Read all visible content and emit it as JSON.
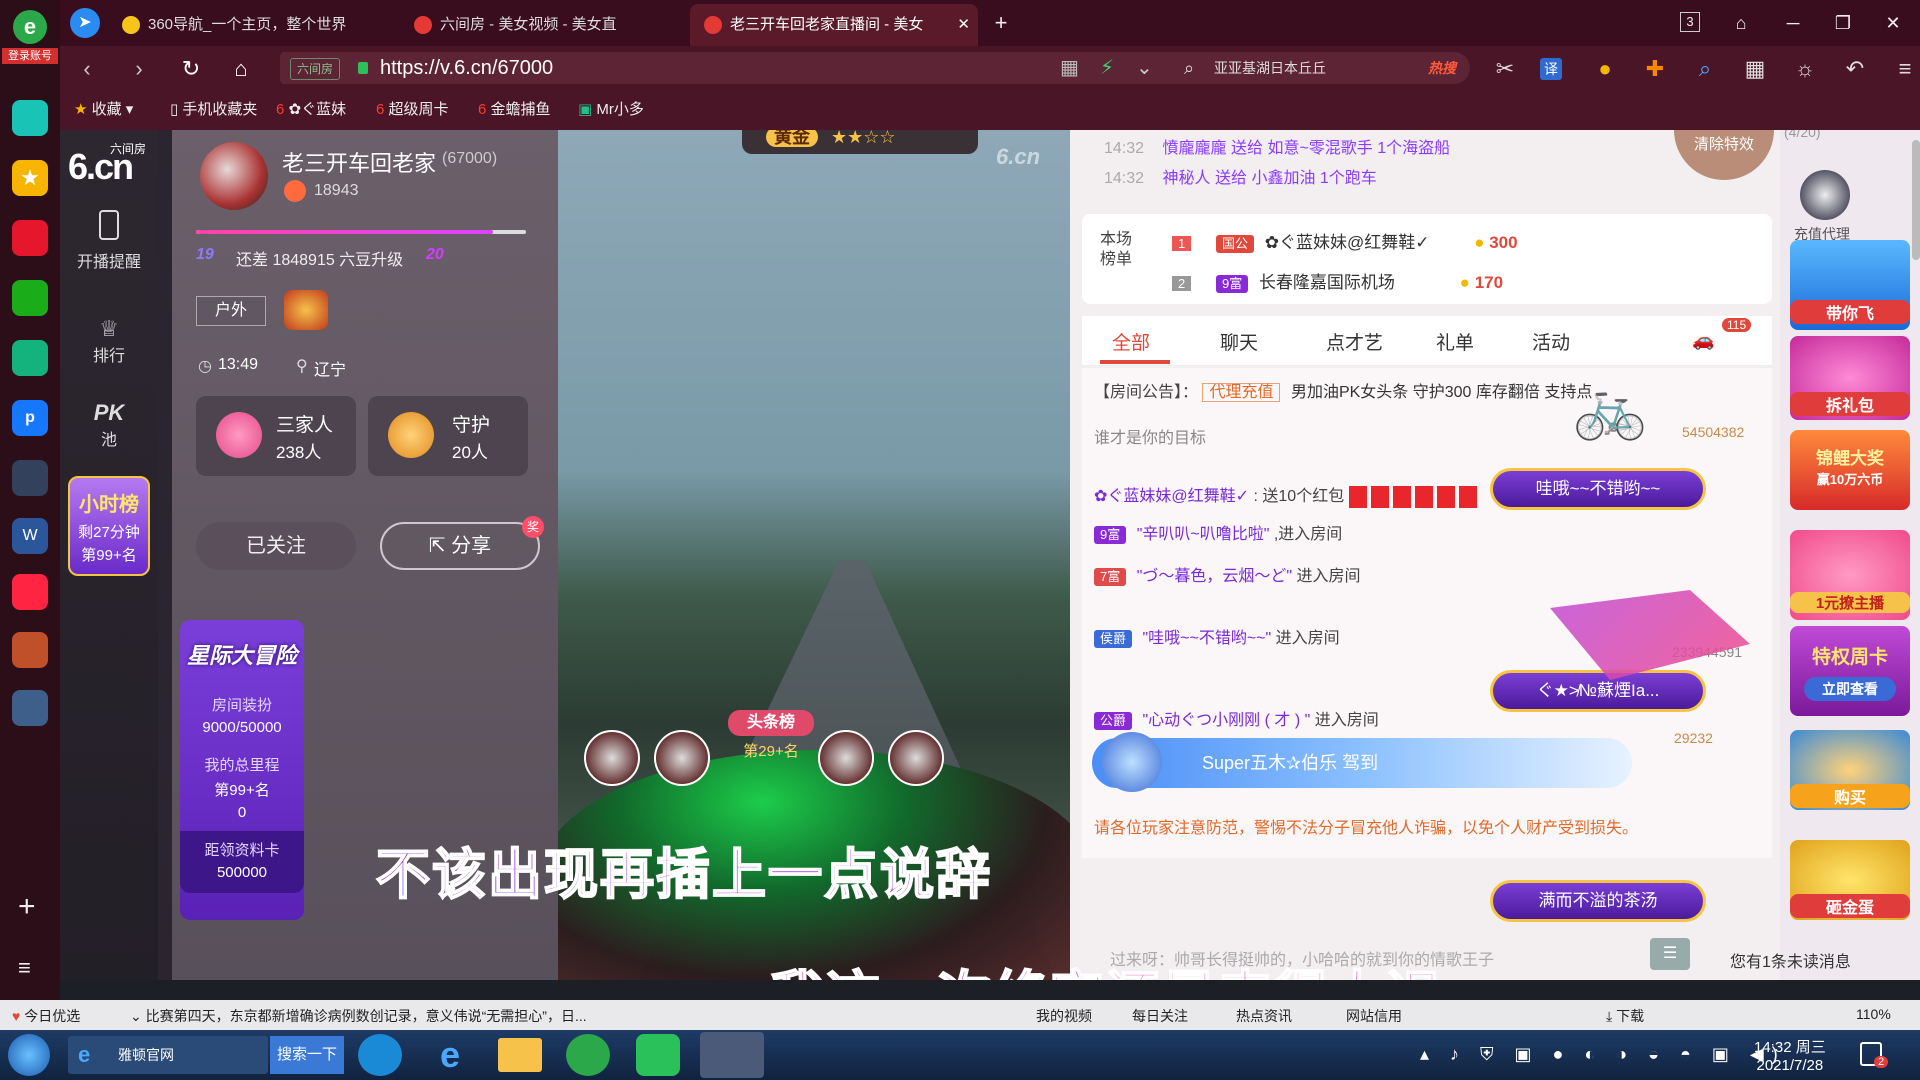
{
  "browser": {
    "tabs": [
      {
        "label": "360导航_一个主页，整个世界"
      },
      {
        "label": "六间房 - 美女视频 - 美女直"
      },
      {
        "label": "老三开车回老家直播间 - 美女"
      }
    ],
    "tab_count": "3",
    "url_site_tag": "六间房",
    "url": "https://v.6.cn/67000",
    "search_text": "亚亚基湖日本丘丘",
    "search_hot": "热搜",
    "translate": "译",
    "login_label": "登录账号"
  },
  "bookmarks": [
    "收藏",
    "手机收藏夹",
    "✿ぐ蓝妹",
    "超级周卡",
    "金蟾捕鱼",
    "Mr小多"
  ],
  "sidenav": {
    "logo_top": "六间房",
    "logo": "6.cn",
    "items": [
      {
        "label": "开播提醒"
      },
      {
        "label": "排行"
      },
      {
        "label": "PK池",
        "main": "PK",
        "sub": "池"
      }
    ],
    "hour_rank": {
      "title": "小时榜",
      "remain": "剩27分钟",
      "rank": "第99+名"
    }
  },
  "anchor": {
    "name": "老三开车回老家",
    "room_id": "(67000)",
    "fans": "18943",
    "level_from": "19",
    "level_to": "20",
    "upgrade_text": "还差 1848915 六豆升级",
    "category": "户外",
    "time": "13:49",
    "location": "辽宁",
    "family": {
      "title": "三家人",
      "count": "238人"
    },
    "guard": {
      "title": "守护",
      "count": "20人"
    },
    "follow_label": "已关注",
    "share_label": "分享",
    "event": {
      "title": "星际大冒险",
      "decor_label": "房间装扮",
      "decor_value": "9000/50000",
      "mileage_label": "我的总里程",
      "mileage_rank": "第99+名",
      "mileage_value": "0",
      "card_label": "距领资料卡",
      "card_value": "500000"
    }
  },
  "video": {
    "watermark": "6.cn",
    "level_badge": "黄金",
    "stars": "★★☆☆",
    "headline_badge": "头条榜",
    "headline_rank": "第29+名",
    "subtitle_1": "不该出现再插上一点说辞",
    "subtitle_2": "我这一次终究还是来得太迟"
  },
  "gifts": [
    {
      "time": "14:32",
      "user": "憤龐龐龐",
      "action": "送给",
      "target": "如意~零混歌手",
      "gift": "1个海盗船"
    },
    {
      "time": "14:32",
      "user": "神秘人",
      "action": "送给",
      "target": "小鑫加油",
      "gift": "1个跑车"
    }
  ],
  "clear_effects": "清除特效",
  "room_rank": {
    "label": "本场榜单",
    "rows": [
      {
        "pos": "1",
        "badge": "国公",
        "name": "✿ぐ蓝妹妹@红舞鞋✓",
        "score": "300"
      },
      {
        "pos": "2",
        "badge": "9富",
        "name": "长春隆嘉国际机场",
        "score": "170"
      }
    ]
  },
  "chat_tabs": [
    "全部",
    "聊天",
    "点才艺",
    "礼单",
    "活动"
  ],
  "car_count": "115",
  "announcement": {
    "label": "【房间公告】：",
    "tag": "代理充值",
    "text": "男加油PK女头条 守护300 库存翻倍 支持点"
  },
  "chat": [
    {
      "text": "谁才是你的目标",
      "num": "54504382"
    },
    {
      "user": "✿ぐ蓝妹妹@红舞鞋✓",
      "text": ": 送10个红包"
    },
    {
      "badge": "9富",
      "user": "\"辛叭叭~叭噜比啦\"",
      "text": ",进入房间"
    },
    {
      "badge": "7富",
      "user": "\"づ〜暮色，云烟〜ど\"",
      "text": "进入房间"
    },
    {
      "badge": "侯爵",
      "user": "\"哇哦~~不错哟~~\"",
      "text": "进入房间",
      "num": "233944591"
    },
    {
      "badge": "公爵",
      "user": "\"心动ぐつ小刚刚 ( 才 ) \"",
      "text": "进入房间",
      "num": "29232"
    }
  ],
  "banners": [
    "哇哦~~不错哟~~",
    "ぐ★≯№蘇煙Ia...",
    "满而不溢的茶汤"
  ],
  "arrival": "Super五木✰伯乐 驾到",
  "warning": "请各位玩家注意防范，警惕不法分子冒充他人诈骗，以免个人财产受到损失。",
  "bottom_chat": "过来呀：帅哥长得挺帅的，小哈哈的就到你的情歌王子",
  "unread": "您有1条未读消息",
  "right": {
    "guard_count": "(4/20)",
    "items": [
      {
        "label": "充值代理"
      },
      {
        "label": "带你飞"
      },
      {
        "label": "拆礼包"
      },
      {
        "label": "锦鲤大奖",
        "sub": "赢10万六币"
      },
      {
        "label": "1元撩主播"
      },
      {
        "label": "特权周卡",
        "sub": "立即查看"
      },
      {
        "label": "购买"
      },
      {
        "label": "砸金蛋"
      }
    ]
  },
  "statusbar": {
    "today": "今日优选",
    "news": "比赛第四天，东京都新增确诊病例数创记录，意义伟说“无需担心”，日...",
    "links": [
      "我的视频",
      "每日关注",
      "热点资讯",
      "网站信用"
    ],
    "download": "下载",
    "zoom": "110%"
  },
  "taskbar": {
    "items": [
      {
        "label": "雅顿官网"
      },
      {
        "label": "搜索一下"
      }
    ],
    "time": "14:32 周三",
    "date": "2021/7/28",
    "notif_count": "2"
  }
}
